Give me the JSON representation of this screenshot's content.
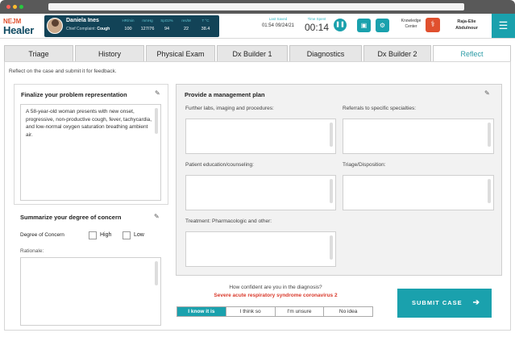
{
  "header": {
    "logo_top": "NEJM",
    "logo_bottom": "Healer",
    "patient": {
      "name": "Daniela Ines",
      "cc_label": "Chief Complaint:",
      "cc_value": "Cough"
    },
    "vitals": [
      {
        "label": "HR/min",
        "value": "100"
      },
      {
        "label": "mmHg",
        "value": "127/76"
      },
      {
        "label": "SpO2%",
        "value": "94"
      },
      {
        "label": "res/M",
        "value": "22"
      },
      {
        "label": "T °C",
        "value": "38.4"
      }
    ],
    "last_saved_label": "Last Saved",
    "last_saved_value": "01:54 09/24/21",
    "timer_label": "Time Spent",
    "timer_value": "00:14",
    "knowledge_center_line1": "Knowledge",
    "knowledge_center_line2": "Center",
    "user_line1": "Raja-Elie",
    "user_line2": "Abdulnour",
    "icons": {
      "pause": "pause-icon",
      "save": "save-icon",
      "settings": "gear-icon",
      "knowledge": "stethoscope-icon",
      "menu": "hamburger-menu-icon"
    }
  },
  "tabs": [
    {
      "label": "Triage"
    },
    {
      "label": "History"
    },
    {
      "label": "Physical Exam"
    },
    {
      "label": "Dx Builder 1"
    },
    {
      "label": "Diagnostics"
    },
    {
      "label": "Dx Builder 2"
    },
    {
      "label": "Reflect",
      "active": true
    }
  ],
  "instruction": "Reflect on the case and submit it for feedback.",
  "problem_rep": {
    "title": "Finalize your problem representation",
    "text": "A 58-year-old woman presents with new onset, progressive, non-productive cough, fever, tachycardia, and low-normal oxygen saturation breathing ambient air."
  },
  "concern": {
    "title": "Summarize your degree of concern",
    "degree_label": "Degree of Concern",
    "option_high": "High",
    "option_low": "Low",
    "rationale_label": "Rationale:"
  },
  "management": {
    "title": "Provide a management plan",
    "labs_label": "Further labs, imaging and procedures:",
    "referrals_label": "Referrals to specific specialties:",
    "education_label": "Patient education/counseling:",
    "triage_label": "Triage/Disposition:",
    "treatment_label": "Treatment: Pharmacologic and other:"
  },
  "confidence": {
    "question": "How confident are you in the diagnosis?",
    "diagnosis": "Severe acute respiratory syndrome coronavirus 2",
    "options": [
      "I know it is",
      "I think so",
      "I'm unsure",
      "No idea"
    ],
    "selected": "I know it is"
  },
  "submit_label": "SUBMIT CASE",
  "colors": {
    "accent": "#1aa1ad",
    "dark_bar": "#124357",
    "brand_red": "#e0502e",
    "diagnosis_red": "#d9382a"
  }
}
